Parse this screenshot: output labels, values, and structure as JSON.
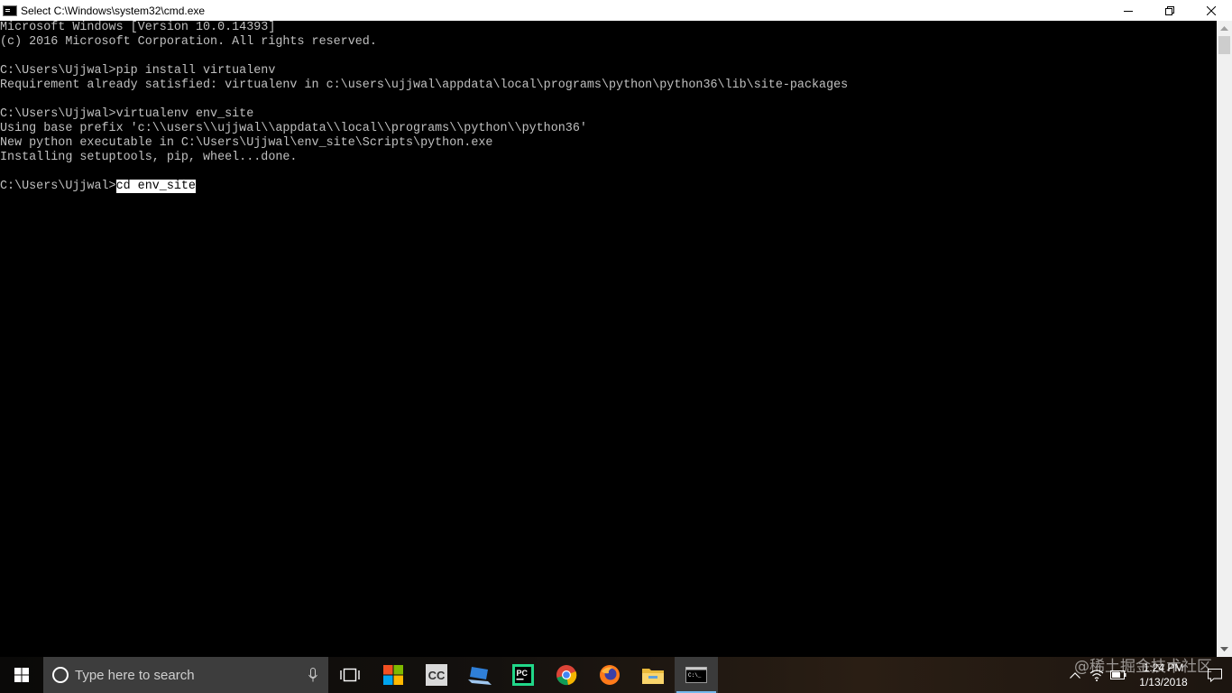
{
  "window": {
    "title": "Select C:\\Windows\\system32\\cmd.exe",
    "icon": "cmd-icon",
    "controls": [
      "minimize",
      "maximize",
      "close"
    ]
  },
  "console": {
    "lines": [
      "Microsoft Windows [Version 10.0.14393]",
      "(c) 2016 Microsoft Corporation. All rights reserved.",
      "",
      "C:\\Users\\Ujjwal>pip install virtualenv",
      "Requirement already satisfied: virtualenv in c:\\users\\ujjwal\\appdata\\local\\programs\\python\\python36\\lib\\site-packages",
      "",
      "C:\\Users\\Ujjwal>virtualenv env_site",
      "Using base prefix 'c:\\\\users\\\\ujjwal\\\\appdata\\\\local\\\\programs\\\\python\\\\python36'",
      "New python executable in C:\\Users\\Ujjwal\\env_site\\Scripts\\python.exe",
      "Installing setuptools, pip, wheel...done.",
      ""
    ],
    "prompt": "C:\\Users\\Ujjwal>",
    "selected_command": "cd env_site",
    "text_color": "#c0c0c0",
    "background": "#000000"
  },
  "taskbar": {
    "search_placeholder": "Type here to search",
    "pinned_apps": [
      "task-view",
      "microsoft-store",
      "cc-app",
      "laptop-app",
      "pycharm",
      "chrome",
      "firefox",
      "file-explorer",
      "command-prompt"
    ],
    "active_app": "command-prompt",
    "clock_time": "1:24 PM",
    "clock_date": "1/13/2018"
  },
  "watermark": "@稀土掘金技术社区"
}
